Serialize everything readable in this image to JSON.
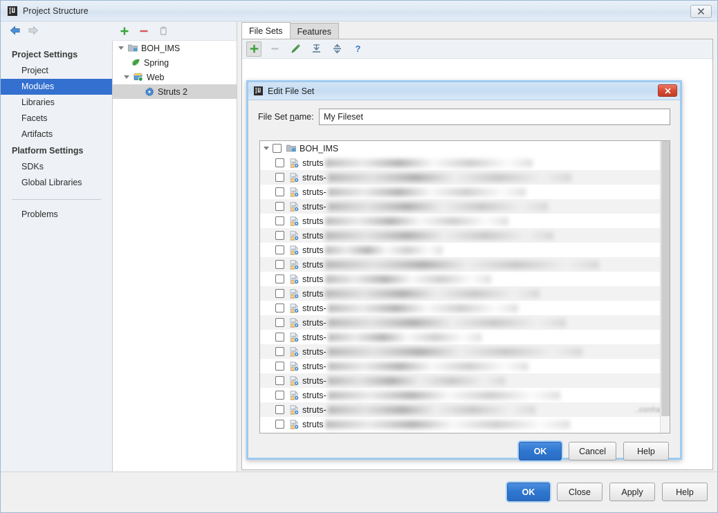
{
  "window": {
    "title": "Project Structure",
    "icon": "idea-logo-icon",
    "close_label": "✖"
  },
  "nav": {
    "back": "back-arrow",
    "forward": "forward-arrow"
  },
  "sidebar": {
    "groups": [
      {
        "label": "Project Settings",
        "items": [
          {
            "label": "Project",
            "selected": false
          },
          {
            "label": "Modules",
            "selected": true
          },
          {
            "label": "Libraries",
            "selected": false
          },
          {
            "label": "Facets",
            "selected": false
          },
          {
            "label": "Artifacts",
            "selected": false
          }
        ]
      },
      {
        "label": "Platform Settings",
        "items": [
          {
            "label": "SDKs",
            "selected": false
          },
          {
            "label": "Global Libraries",
            "selected": false
          }
        ]
      }
    ],
    "footer_item": "Problems"
  },
  "module_panel": {
    "toolbar": [
      {
        "name": "add-module-button",
        "glyph": "+"
      },
      {
        "name": "remove-module-button",
        "glyph": "−"
      },
      {
        "name": "copy-module-button",
        "glyph": "copy"
      }
    ],
    "tree": [
      {
        "label": "BOH_IMS",
        "icon": "module-icon",
        "depth": 0,
        "expanded": true,
        "selected": false
      },
      {
        "label": "Spring",
        "icon": "spring-leaf-icon",
        "depth": 1,
        "expanded": null,
        "selected": false
      },
      {
        "label": "Web",
        "icon": "web-facet-icon",
        "depth": 1,
        "expanded": true,
        "selected": false
      },
      {
        "label": "Struts 2",
        "icon": "struts-gear-icon",
        "depth": 2,
        "expanded": null,
        "selected": true
      }
    ]
  },
  "content": {
    "tabs": [
      {
        "label": "File Sets",
        "active": true
      },
      {
        "label": "Features",
        "active": false
      }
    ],
    "toolbar": [
      {
        "name": "add-fileset-button",
        "glyph": "plus",
        "state": "pressed"
      },
      {
        "name": "remove-fileset-button",
        "glyph": "minus",
        "state": "disabled"
      },
      {
        "name": "edit-fileset-button",
        "glyph": "pencil",
        "state": "enabled"
      },
      {
        "name": "expand-all-button",
        "glyph": "expand-all",
        "state": "enabled"
      },
      {
        "name": "collapse-all-button",
        "glyph": "collapse-all",
        "state": "enabled"
      },
      {
        "name": "help-button",
        "glyph": "question",
        "state": "enabled"
      }
    ]
  },
  "modal": {
    "title": "Edit File Set",
    "icon": "idea-logo-icon",
    "close_label": "✖",
    "name_field": {
      "label_pre": "File Set ",
      "label_mnemonic": "n",
      "label_post": "ame:",
      "value": "My Fileset",
      "placeholder": ""
    },
    "tree": {
      "root": {
        "label": "BOH_IMS",
        "icon": "module-icon",
        "expanded": true,
        "checked": false
      },
      "children": [
        {
          "label": "struts",
          "icon": "struts-xml-icon",
          "checked": false,
          "blur_width": 300,
          "far_path": ""
        },
        {
          "label": "struts-",
          "icon": "struts-xml-icon",
          "checked": false,
          "blur_width": 352,
          "far_path": ""
        },
        {
          "label": "struts-",
          "icon": "struts-xml-icon",
          "checked": false,
          "blur_width": 286,
          "far_path": ""
        },
        {
          "label": "struts-",
          "icon": "struts-xml-icon",
          "checked": false,
          "blur_width": 318,
          "far_path": ""
        },
        {
          "label": "struts",
          "icon": "struts-xml-icon",
          "checked": false,
          "blur_width": 265,
          "far_path": ""
        },
        {
          "label": "struts",
          "icon": "struts-xml-icon",
          "checked": false,
          "blur_width": 330,
          "far_path": ""
        },
        {
          "label": "struts",
          "icon": "struts-xml-icon",
          "checked": false,
          "blur_width": 170,
          "far_path": ""
        },
        {
          "label": "struts",
          "icon": "struts-xml-icon",
          "checked": false,
          "blur_width": 396,
          "far_path": ""
        },
        {
          "label": "struts",
          "icon": "struts-xml-icon",
          "checked": false,
          "blur_width": 240,
          "far_path": ""
        },
        {
          "label": "struts",
          "icon": "struts-xml-icon",
          "checked": false,
          "blur_width": 310,
          "far_path": ""
        },
        {
          "label": "struts-",
          "icon": "struts-xml-icon",
          "checked": false,
          "blur_width": 275,
          "far_path": ""
        },
        {
          "label": "struts-",
          "icon": "struts-xml-icon",
          "checked": false,
          "blur_width": 344,
          "far_path": ""
        },
        {
          "label": "struts-",
          "icon": "struts-xml-icon",
          "checked": false,
          "blur_width": 222,
          "far_path": ""
        },
        {
          "label": "struts-",
          "icon": "struts-xml-icon",
          "checked": false,
          "blur_width": 368,
          "far_path": ""
        },
        {
          "label": "struts-",
          "icon": "struts-xml-icon",
          "checked": false,
          "blur_width": 290,
          "far_path": ""
        },
        {
          "label": "struts-",
          "icon": "struts-xml-icon",
          "checked": false,
          "blur_width": 256,
          "far_path": ""
        },
        {
          "label": "struts-",
          "icon": "struts-xml-icon",
          "checked": false,
          "blur_width": 336,
          "far_path": ""
        },
        {
          "label": "struts-",
          "icon": "struts-xml-icon",
          "checked": false,
          "blur_width": 300,
          "far_path": "..conha/i"
        },
        {
          "label": "struts",
          "icon": "struts-xml-icon",
          "checked": false,
          "blur_width": 354,
          "far_path": ""
        }
      ]
    },
    "buttons": [
      {
        "label": "OK",
        "primary": true,
        "name": "modal-ok-button"
      },
      {
        "label": "Cancel",
        "primary": false,
        "name": "modal-cancel-button"
      },
      {
        "label": "Help",
        "primary": false,
        "name": "modal-help-button"
      }
    ]
  },
  "bottom_buttons": [
    {
      "label": "OK",
      "primary": true,
      "name": "ok-button"
    },
    {
      "label": "Close",
      "primary": false,
      "name": "close-button"
    },
    {
      "label": "Apply",
      "primary": false,
      "name": "apply-button"
    },
    {
      "label": "Help",
      "primary": false,
      "name": "help-button"
    }
  ],
  "colors": {
    "accent_blue": "#3470cf",
    "selection_blue": "#3470cf",
    "modal_border": "#9ecbf0",
    "primary_button": "#2f76cf",
    "close_red": "#d94a31"
  }
}
